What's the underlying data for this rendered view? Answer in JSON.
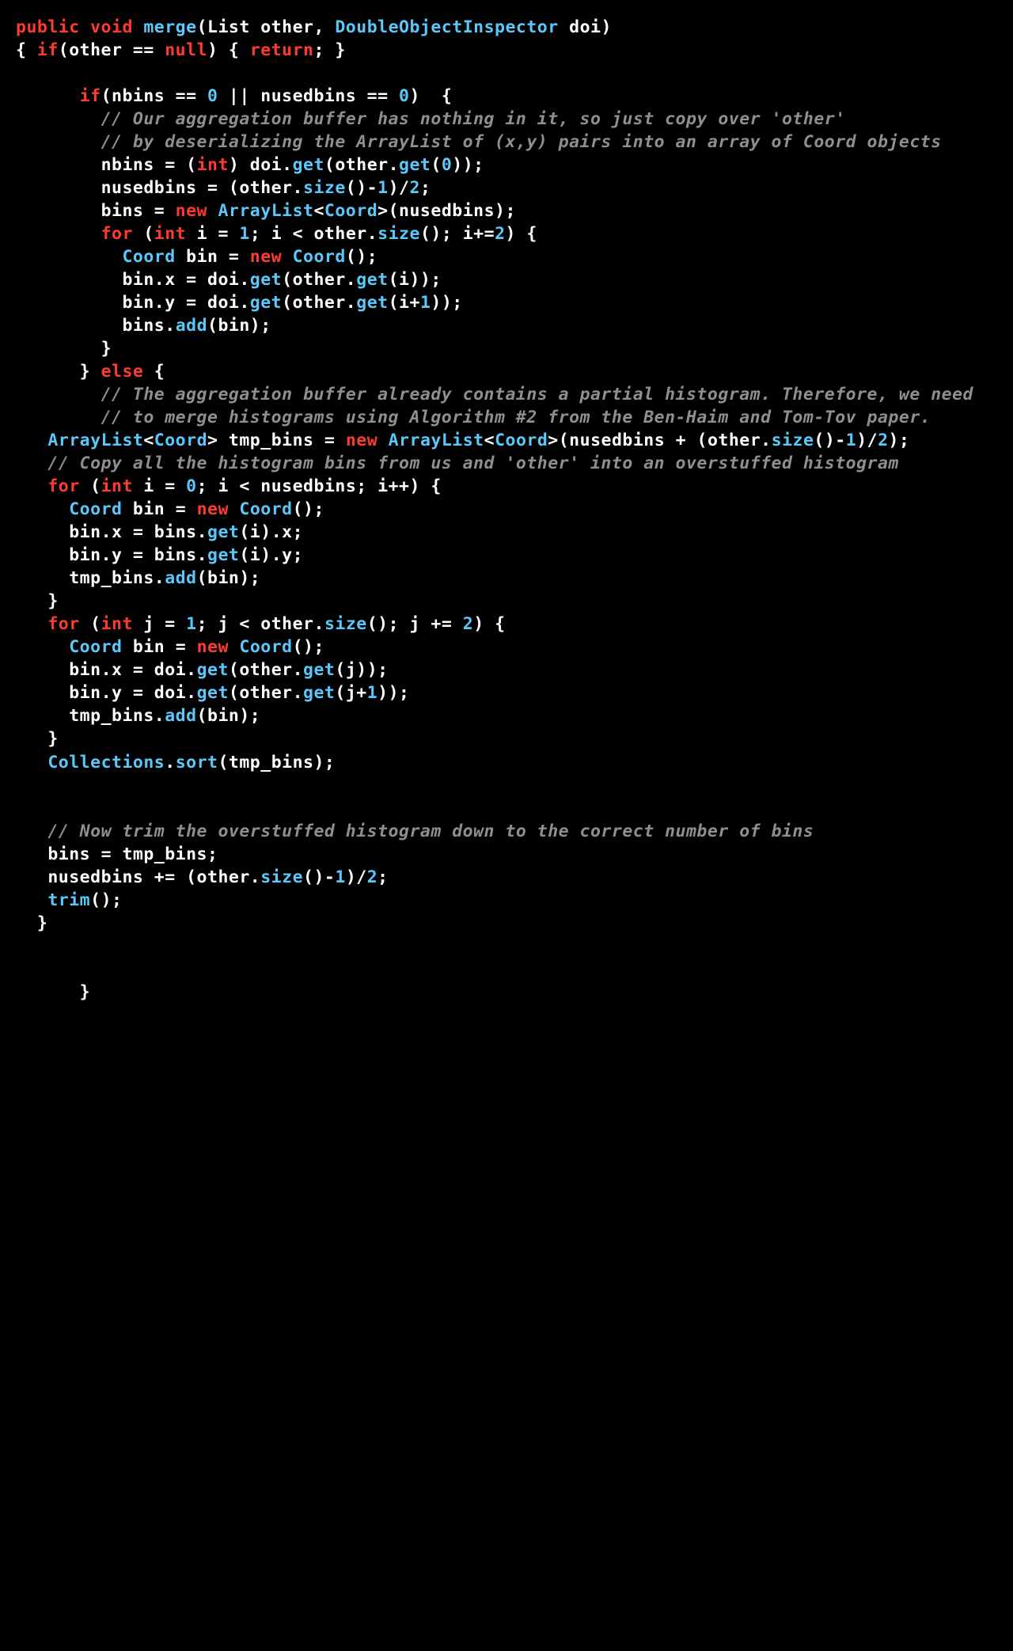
{
  "code": {
    "lines": [
      [
        {
          "cls": "kw",
          "t": "public void"
        },
        {
          "cls": "txt",
          "t": " "
        },
        {
          "cls": "mtd",
          "t": "merge"
        },
        {
          "cls": "txt",
          "t": "(List other, "
        },
        {
          "cls": "type",
          "t": "DoubleObjectInspector"
        },
        {
          "cls": "txt",
          "t": " doi)"
        }
      ],
      [
        {
          "cls": "txt",
          "t": "{ "
        },
        {
          "cls": "kw",
          "t": "if"
        },
        {
          "cls": "txt",
          "t": "(other == "
        },
        {
          "cls": "kw",
          "t": "null"
        },
        {
          "cls": "txt",
          "t": ") { "
        },
        {
          "cls": "kw",
          "t": "return"
        },
        {
          "cls": "txt",
          "t": "; }"
        }
      ],
      [
        {
          "cls": "txt",
          "t": ""
        }
      ],
      [
        {
          "cls": "txt",
          "t": "      "
        },
        {
          "cls": "kw",
          "t": "if"
        },
        {
          "cls": "txt",
          "t": "(nbins == "
        },
        {
          "cls": "num",
          "t": "0"
        },
        {
          "cls": "txt",
          "t": " || nusedbins == "
        },
        {
          "cls": "num",
          "t": "0"
        },
        {
          "cls": "txt",
          "t": ")  {"
        }
      ],
      [
        {
          "cls": "txt",
          "t": "        "
        },
        {
          "cls": "cmt",
          "t": "// Our aggregation buffer has nothing in it, so just copy over 'other'"
        }
      ],
      [
        {
          "cls": "txt",
          "t": "        "
        },
        {
          "cls": "cmt",
          "t": "// by deserializing the ArrayList of (x,y) pairs into an array of Coord objects"
        }
      ],
      [
        {
          "cls": "txt",
          "t": "        nbins = ("
        },
        {
          "cls": "kw",
          "t": "int"
        },
        {
          "cls": "txt",
          "t": ") doi."
        },
        {
          "cls": "mtd",
          "t": "get"
        },
        {
          "cls": "txt",
          "t": "(other."
        },
        {
          "cls": "mtd",
          "t": "get"
        },
        {
          "cls": "txt",
          "t": "("
        },
        {
          "cls": "num",
          "t": "0"
        },
        {
          "cls": "txt",
          "t": "));"
        }
      ],
      [
        {
          "cls": "txt",
          "t": "        nusedbins = (other."
        },
        {
          "cls": "mtd",
          "t": "size"
        },
        {
          "cls": "txt",
          "t": "()-"
        },
        {
          "cls": "num",
          "t": "1"
        },
        {
          "cls": "txt",
          "t": ")/"
        },
        {
          "cls": "num",
          "t": "2"
        },
        {
          "cls": "txt",
          "t": ";"
        }
      ],
      [
        {
          "cls": "txt",
          "t": "        bins = "
        },
        {
          "cls": "kw",
          "t": "new"
        },
        {
          "cls": "txt",
          "t": " "
        },
        {
          "cls": "type",
          "t": "ArrayList"
        },
        {
          "cls": "txt",
          "t": "<"
        },
        {
          "cls": "type",
          "t": "Coord"
        },
        {
          "cls": "txt",
          "t": ">(nusedbins);"
        }
      ],
      [
        {
          "cls": "txt",
          "t": "        "
        },
        {
          "cls": "kw",
          "t": "for"
        },
        {
          "cls": "txt",
          "t": " ("
        },
        {
          "cls": "kw",
          "t": "int"
        },
        {
          "cls": "txt",
          "t": " i = "
        },
        {
          "cls": "num",
          "t": "1"
        },
        {
          "cls": "txt",
          "t": "; i < other."
        },
        {
          "cls": "mtd",
          "t": "size"
        },
        {
          "cls": "txt",
          "t": "(); i+="
        },
        {
          "cls": "num",
          "t": "2"
        },
        {
          "cls": "txt",
          "t": ") {"
        }
      ],
      [
        {
          "cls": "txt",
          "t": "          "
        },
        {
          "cls": "type",
          "t": "Coord"
        },
        {
          "cls": "txt",
          "t": " bin = "
        },
        {
          "cls": "kw",
          "t": "new"
        },
        {
          "cls": "txt",
          "t": " "
        },
        {
          "cls": "type",
          "t": "Coord"
        },
        {
          "cls": "txt",
          "t": "();"
        }
      ],
      [
        {
          "cls": "txt",
          "t": "          bin.x = doi."
        },
        {
          "cls": "mtd",
          "t": "get"
        },
        {
          "cls": "txt",
          "t": "(other."
        },
        {
          "cls": "mtd",
          "t": "get"
        },
        {
          "cls": "txt",
          "t": "(i));"
        }
      ],
      [
        {
          "cls": "txt",
          "t": "          bin.y = doi."
        },
        {
          "cls": "mtd",
          "t": "get"
        },
        {
          "cls": "txt",
          "t": "(other."
        },
        {
          "cls": "mtd",
          "t": "get"
        },
        {
          "cls": "txt",
          "t": "(i+"
        },
        {
          "cls": "num",
          "t": "1"
        },
        {
          "cls": "txt",
          "t": "));"
        }
      ],
      [
        {
          "cls": "txt",
          "t": "          bins."
        },
        {
          "cls": "mtd",
          "t": "add"
        },
        {
          "cls": "txt",
          "t": "(bin);"
        }
      ],
      [
        {
          "cls": "txt",
          "t": "        }"
        }
      ],
      [
        {
          "cls": "txt",
          "t": "      } "
        },
        {
          "cls": "kw",
          "t": "else"
        },
        {
          "cls": "txt",
          "t": " {"
        }
      ],
      [
        {
          "cls": "txt",
          "t": "        "
        },
        {
          "cls": "cmt",
          "t": "// The aggregation buffer already contains a partial histogram. Therefore, we need"
        }
      ],
      [
        {
          "cls": "txt",
          "t": "        "
        },
        {
          "cls": "cmt",
          "t": "// to merge histograms using Algorithm #2 from the Ben-Haim and Tom-Tov paper."
        }
      ],
      [
        {
          "cls": "txt",
          "t": "   "
        },
        {
          "cls": "type",
          "t": "ArrayList"
        },
        {
          "cls": "txt",
          "t": "<"
        },
        {
          "cls": "type",
          "t": "Coord"
        },
        {
          "cls": "txt",
          "t": "> tmp_bins = "
        },
        {
          "cls": "kw",
          "t": "new"
        },
        {
          "cls": "txt",
          "t": " "
        },
        {
          "cls": "type",
          "t": "ArrayList"
        },
        {
          "cls": "txt",
          "t": "<"
        },
        {
          "cls": "type",
          "t": "Coord"
        },
        {
          "cls": "txt",
          "t": ">(nusedbins + (other."
        },
        {
          "cls": "mtd",
          "t": "size"
        },
        {
          "cls": "txt",
          "t": "()-"
        },
        {
          "cls": "num",
          "t": "1"
        },
        {
          "cls": "txt",
          "t": ")/"
        },
        {
          "cls": "num",
          "t": "2"
        },
        {
          "cls": "txt",
          "t": ");"
        }
      ],
      [
        {
          "cls": "txt",
          "t": "   "
        },
        {
          "cls": "cmt",
          "t": "// Copy all the histogram bins from us and 'other' into an overstuffed histogram"
        }
      ],
      [
        {
          "cls": "txt",
          "t": "   "
        },
        {
          "cls": "kw",
          "t": "for"
        },
        {
          "cls": "txt",
          "t": " ("
        },
        {
          "cls": "kw",
          "t": "int"
        },
        {
          "cls": "txt",
          "t": " i = "
        },
        {
          "cls": "num",
          "t": "0"
        },
        {
          "cls": "txt",
          "t": "; i < nusedbins; i++) {"
        }
      ],
      [
        {
          "cls": "txt",
          "t": "     "
        },
        {
          "cls": "type",
          "t": "Coord"
        },
        {
          "cls": "txt",
          "t": " bin = "
        },
        {
          "cls": "kw",
          "t": "new"
        },
        {
          "cls": "txt",
          "t": " "
        },
        {
          "cls": "type",
          "t": "Coord"
        },
        {
          "cls": "txt",
          "t": "();"
        }
      ],
      [
        {
          "cls": "txt",
          "t": "     bin.x = bins."
        },
        {
          "cls": "mtd",
          "t": "get"
        },
        {
          "cls": "txt",
          "t": "(i).x;"
        }
      ],
      [
        {
          "cls": "txt",
          "t": "     bin.y = bins."
        },
        {
          "cls": "mtd",
          "t": "get"
        },
        {
          "cls": "txt",
          "t": "(i).y;"
        }
      ],
      [
        {
          "cls": "txt",
          "t": "     tmp_bins."
        },
        {
          "cls": "mtd",
          "t": "add"
        },
        {
          "cls": "txt",
          "t": "(bin);"
        }
      ],
      [
        {
          "cls": "txt",
          "t": "   }"
        }
      ],
      [
        {
          "cls": "txt",
          "t": "   "
        },
        {
          "cls": "kw",
          "t": "for"
        },
        {
          "cls": "txt",
          "t": " ("
        },
        {
          "cls": "kw",
          "t": "int"
        },
        {
          "cls": "txt",
          "t": " j = "
        },
        {
          "cls": "num",
          "t": "1"
        },
        {
          "cls": "txt",
          "t": "; j < other."
        },
        {
          "cls": "mtd",
          "t": "size"
        },
        {
          "cls": "txt",
          "t": "(); j += "
        },
        {
          "cls": "num",
          "t": "2"
        },
        {
          "cls": "txt",
          "t": ") {"
        }
      ],
      [
        {
          "cls": "txt",
          "t": "     "
        },
        {
          "cls": "type",
          "t": "Coord"
        },
        {
          "cls": "txt",
          "t": " bin = "
        },
        {
          "cls": "kw",
          "t": "new"
        },
        {
          "cls": "txt",
          "t": " "
        },
        {
          "cls": "type",
          "t": "Coord"
        },
        {
          "cls": "txt",
          "t": "();"
        }
      ],
      [
        {
          "cls": "txt",
          "t": "     bin.x = doi."
        },
        {
          "cls": "mtd",
          "t": "get"
        },
        {
          "cls": "txt",
          "t": "(other."
        },
        {
          "cls": "mtd",
          "t": "get"
        },
        {
          "cls": "txt",
          "t": "(j));"
        }
      ],
      [
        {
          "cls": "txt",
          "t": "     bin.y = doi."
        },
        {
          "cls": "mtd",
          "t": "get"
        },
        {
          "cls": "txt",
          "t": "(other."
        },
        {
          "cls": "mtd",
          "t": "get"
        },
        {
          "cls": "txt",
          "t": "(j+"
        },
        {
          "cls": "num",
          "t": "1"
        },
        {
          "cls": "txt",
          "t": "));"
        }
      ],
      [
        {
          "cls": "txt",
          "t": "     tmp_bins."
        },
        {
          "cls": "mtd",
          "t": "add"
        },
        {
          "cls": "txt",
          "t": "(bin);"
        }
      ],
      [
        {
          "cls": "txt",
          "t": "   }"
        }
      ],
      [
        {
          "cls": "txt",
          "t": "   "
        },
        {
          "cls": "type",
          "t": "Collections"
        },
        {
          "cls": "txt",
          "t": "."
        },
        {
          "cls": "mtd",
          "t": "sort"
        },
        {
          "cls": "txt",
          "t": "(tmp_bins);"
        }
      ],
      [
        {
          "cls": "txt",
          "t": ""
        }
      ],
      [
        {
          "cls": "txt",
          "t": ""
        }
      ],
      [
        {
          "cls": "txt",
          "t": "   "
        },
        {
          "cls": "cmt",
          "t": "// Now trim the overstuffed histogram down to the correct number of bins"
        }
      ],
      [
        {
          "cls": "txt",
          "t": "   bins = tmp_bins;"
        }
      ],
      [
        {
          "cls": "txt",
          "t": "   nusedbins += (other."
        },
        {
          "cls": "mtd",
          "t": "size"
        },
        {
          "cls": "txt",
          "t": "()-"
        },
        {
          "cls": "num",
          "t": "1"
        },
        {
          "cls": "txt",
          "t": ")/"
        },
        {
          "cls": "num",
          "t": "2"
        },
        {
          "cls": "txt",
          "t": ";"
        }
      ],
      [
        {
          "cls": "txt",
          "t": "   "
        },
        {
          "cls": "mtd",
          "t": "trim"
        },
        {
          "cls": "txt",
          "t": "();"
        }
      ],
      [
        {
          "cls": "txt",
          "t": "  }"
        }
      ],
      [
        {
          "cls": "txt",
          "t": ""
        }
      ],
      [
        {
          "cls": "txt",
          "t": ""
        }
      ],
      [
        {
          "cls": "txt",
          "t": "      }"
        }
      ]
    ]
  }
}
